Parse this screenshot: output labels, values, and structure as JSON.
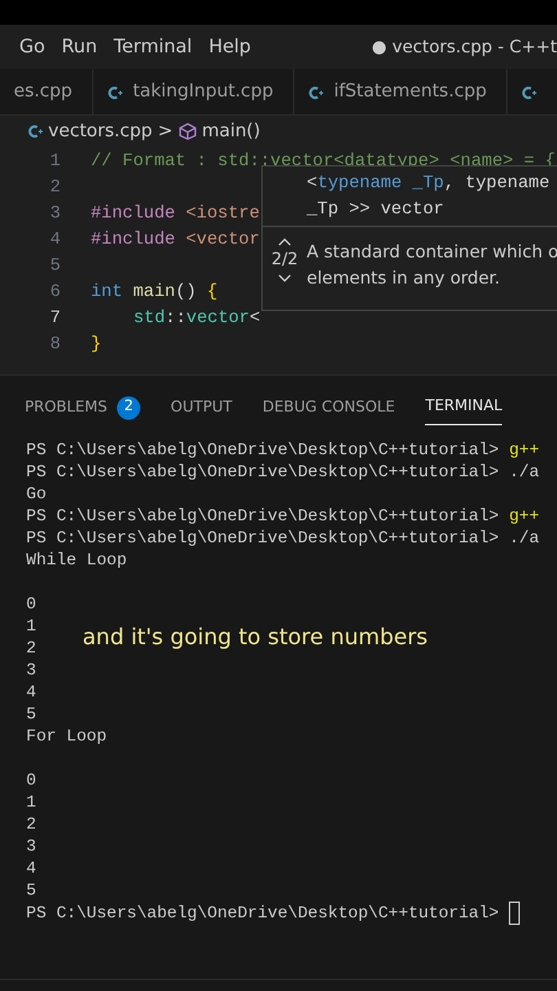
{
  "menu": [
    "Go",
    "Run",
    "Terminal",
    "Help"
  ],
  "window_title": "● vectors.cpp - C++t",
  "tabs": [
    {
      "label": "es.cpp",
      "selected": false,
      "icon": false
    },
    {
      "label": "takingInput.cpp",
      "selected": false,
      "icon": true
    },
    {
      "label": "ifStatements.cpp",
      "selected": false,
      "icon": true
    },
    {
      "selected": false,
      "icon": true
    }
  ],
  "breadcrumb": {
    "file": "vectors.cpp",
    "separator": ">",
    "symbol": "main()"
  },
  "code": [
    {
      "number": "1",
      "current": false,
      "tokens": [
        {
          "t": "// Format : std::vector<datatype> <name> = {",
          "kind": "comment"
        }
      ]
    },
    {
      "number": "2",
      "current": false
    },
    {
      "number": "3",
      "current": false,
      "tokens": [
        {
          "t": "#include",
          "kind": "preproc"
        },
        {
          "t": " <iostre",
          "kind": "string"
        }
      ]
    },
    {
      "number": "4",
      "current": false,
      "tokens": [
        {
          "t": "#include",
          "kind": "preproc"
        },
        {
          "t": " <vector",
          "kind": "string"
        }
      ]
    },
    {
      "number": "5",
      "current": false
    },
    {
      "number": "6",
      "current": false,
      "tokens": [
        {
          "t": "int ",
          "kind": "keyword"
        },
        {
          "t": "main",
          "kind": "func"
        },
        {
          "t": "() ",
          "kind": "plain"
        },
        {
          "t": "{",
          "kind": "bracket"
        }
      ]
    },
    {
      "number": "7",
      "current": true,
      "indented": true,
      "tokens": [
        {
          "t": "std",
          "kind": "ns"
        },
        {
          "t": "::",
          "kind": "plain"
        },
        {
          "t": "vector",
          "kind": "ns"
        },
        {
          "t": "<",
          "kind": "plain"
        }
      ]
    },
    {
      "number": "8",
      "current": false,
      "tokens": [
        {
          "t": "}",
          "kind": "bracket"
        }
      ]
    }
  ],
  "hover": {
    "signature": [
      [
        {
          "t": "<",
          "kind": "plain"
        },
        {
          "t": "typename _Tp",
          "kind": "keyword"
        },
        {
          "t": ", typename",
          "kind": "plain"
        }
      ],
      [
        {
          "t": "_Tp >> vector",
          "kind": "plain"
        }
      ]
    ],
    "counter": "2/2",
    "doc": [
      "A standard container which o",
      "elements in any order."
    ]
  },
  "panel_tabs": [
    {
      "label": "PROBLEMS",
      "badge": "2",
      "selected": false
    },
    {
      "label": "OUTPUT",
      "selected": false
    },
    {
      "label": "DEBUG CONSOLE",
      "selected": false
    },
    {
      "label": "TERMINAL",
      "selected": true
    }
  ],
  "terminal": [
    {
      "kind": "prompt",
      "prompt": "PS C:\\Users\\abelg\\OneDrive\\Desktop\\C++tutorial>",
      "command": "g++",
      "tool": true
    },
    {
      "kind": "prompt",
      "prompt": "PS C:\\Users\\abelg\\OneDrive\\Desktop\\C++tutorial>",
      "command": "./a",
      "tool": false
    },
    {
      "kind": "output",
      "text": "Go"
    },
    {
      "kind": "prompt",
      "prompt": "PS C:\\Users\\abelg\\OneDrive\\Desktop\\C++tutorial>",
      "command": "g++",
      "tool": true
    },
    {
      "kind": "prompt",
      "prompt": "PS C:\\Users\\abelg\\OneDrive\\Desktop\\C++tutorial>",
      "command": "./a",
      "tool": false
    },
    {
      "kind": "output",
      "text": "While Loop"
    },
    {
      "kind": "blank"
    },
    {
      "kind": "output",
      "text": "0"
    },
    {
      "kind": "output",
      "text": "1"
    },
    {
      "kind": "output",
      "text": "2"
    },
    {
      "kind": "output",
      "text": "3"
    },
    {
      "kind": "output",
      "text": "4"
    },
    {
      "kind": "output",
      "text": "5"
    },
    {
      "kind": "output",
      "text": "For Loop"
    },
    {
      "kind": "blank"
    },
    {
      "kind": "output",
      "text": "0"
    },
    {
      "kind": "output",
      "text": "1"
    },
    {
      "kind": "output",
      "text": "2"
    },
    {
      "kind": "output",
      "text": "3"
    },
    {
      "kind": "output",
      "text": "4"
    },
    {
      "kind": "output",
      "text": "5"
    },
    {
      "kind": "prompt",
      "prompt": "PS C:\\Users\\abelg\\OneDrive\\Desktop\\C++tutorial>",
      "cursor": true
    }
  ],
  "caption": "and it's going to store numbers"
}
